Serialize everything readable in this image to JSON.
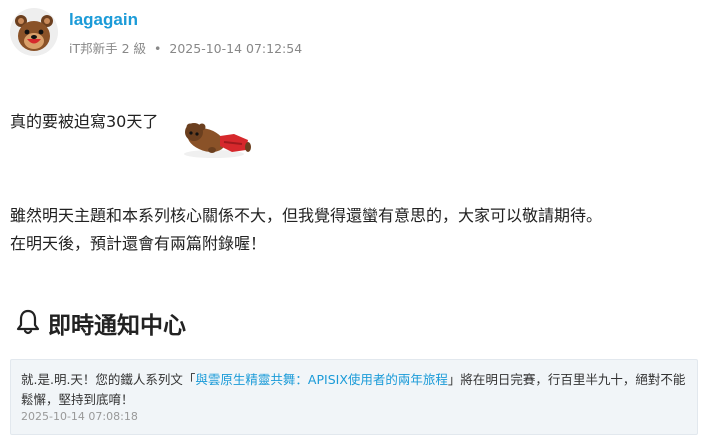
{
  "author": {
    "name": "lagagain",
    "rank": "iT邦新手 2 級",
    "separator": "•",
    "timestamp": "2025-10-14 07:12:54"
  },
  "content": {
    "line1": "真的要被迫寫30天了",
    "line2": "雖然明天主題和本系列核心關係不大，但我覺得還蠻有意思的，大家可以敬請期待。",
    "line3": "在明天後，預計還會有兩篇附錄喔！"
  },
  "notification_section": {
    "icon": "bell-icon",
    "title": "即時通知中心"
  },
  "notification": {
    "prefix": "就.是.明.天！您的鐵人系列文「",
    "link_text": "與雲原生精靈共舞：APISIX使用者的兩年旅程",
    "suffix": "」將在明日完賽，行百里半九十，絕對不能鬆懈，堅持到底唷！",
    "timestamp": "2025-10-14 07:08:18"
  },
  "colors": {
    "link": "#1b9bd8",
    "notice_bg": "#f1f5f8"
  }
}
